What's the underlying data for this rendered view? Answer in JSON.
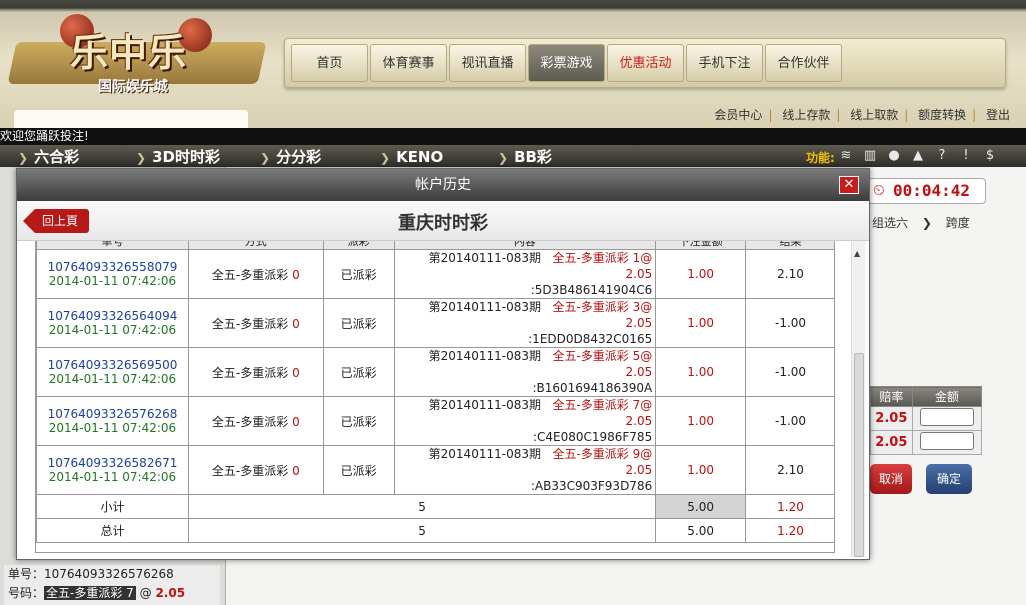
{
  "logo": {
    "title": "乐中乐",
    "subtitle": "国际娱乐城"
  },
  "nav": [
    {
      "label": "首页",
      "state": "normal"
    },
    {
      "label": "体育赛事",
      "state": "normal"
    },
    {
      "label": "视讯直播",
      "state": "normal"
    },
    {
      "label": "彩票游戏",
      "state": "active"
    },
    {
      "label": "优惠活动",
      "state": "highlight"
    },
    {
      "label": "手机下注",
      "state": "normal"
    },
    {
      "label": "合作伙伴",
      "state": "normal"
    }
  ],
  "toplinks": [
    "会员中心",
    "线上存款",
    "线上取款",
    "额度转换",
    "登出"
  ],
  "marquee": "欢迎您踊跃投注!",
  "categories": [
    "六合彩",
    "3D时时彩",
    "分分彩",
    "KENO",
    "BB彩"
  ],
  "func_label": "功能:",
  "func_icons": [
    "coins-icon",
    "chart-icon",
    "user-icon",
    "help-icon",
    "info-icon",
    "shield-icon",
    "dollar-icon"
  ],
  "timer": "00:04:42",
  "right_tabs": [
    "组选六",
    "跨度"
  ],
  "odds": {
    "headers": [
      "赔率",
      "金额"
    ],
    "rows": [
      "2.05",
      "2.05"
    ]
  },
  "buttons": {
    "cancel": "取消",
    "confirm": "确定"
  },
  "left_bottom": {
    "bill_label": "单号：",
    "bill_value": "10764093326576268",
    "num_label": "号码：",
    "num_value": "全五-多重派彩 7",
    "at": "@",
    "odds": "2.05"
  },
  "modal": {
    "title": "帐户历史",
    "close": "✕",
    "back": "回上頁",
    "heading": "重庆时时彩",
    "columns": [
      "单号",
      "方式",
      "派彩",
      "内容",
      "下注金额",
      "结果"
    ],
    "rows": [
      {
        "bill": "10764093326558079",
        "time": "2014-01-11 07:42:06",
        "method": "全五-多重派彩",
        "method_num": "0",
        "status": "已派彩",
        "period": "第20140111-083期",
        "bet": "全五-多重派彩 1@",
        "odds": "2.05",
        "code": ":5D3B486141904C6",
        "amount": "1.00",
        "result": "2.10"
      },
      {
        "bill": "10764093326564094",
        "time": "2014-01-11 07:42:06",
        "method": "全五-多重派彩",
        "method_num": "0",
        "status": "已派彩",
        "period": "第20140111-083期",
        "bet": "全五-多重派彩 3@",
        "odds": "2.05",
        "code": ":1EDD0D8432C0165",
        "amount": "1.00",
        "result": "-1.00"
      },
      {
        "bill": "10764093326569500",
        "time": "2014-01-11 07:42:06",
        "method": "全五-多重派彩",
        "method_num": "0",
        "status": "已派彩",
        "period": "第20140111-083期",
        "bet": "全五-多重派彩 5@",
        "odds": "2.05",
        "code": ":B1601694186390A",
        "amount": "1.00",
        "result": "-1.00"
      },
      {
        "bill": "10764093326576268",
        "time": "2014-01-11 07:42:06",
        "method": "全五-多重派彩",
        "method_num": "0",
        "status": "已派彩",
        "period": "第20140111-083期",
        "bet": "全五-多重派彩 7@",
        "odds": "2.05",
        "code": ":C4E080C1986F785",
        "amount": "1.00",
        "result": "-1.00"
      },
      {
        "bill": "10764093326582671",
        "time": "2014-01-11 07:42:06",
        "method": "全五-多重派彩",
        "method_num": "0",
        "status": "已派彩",
        "period": "第20140111-083期",
        "bet": "全五-多重派彩 9@",
        "odds": "2.05",
        "code": ":AB33C903F93D786",
        "amount": "1.00",
        "result": "2.10"
      }
    ],
    "subtotal": {
      "label": "小计",
      "count": "5",
      "amount": "5.00",
      "result": "1.20"
    },
    "total": {
      "label": "总计",
      "count": "5",
      "amount": "5.00",
      "result": "1.20"
    }
  }
}
